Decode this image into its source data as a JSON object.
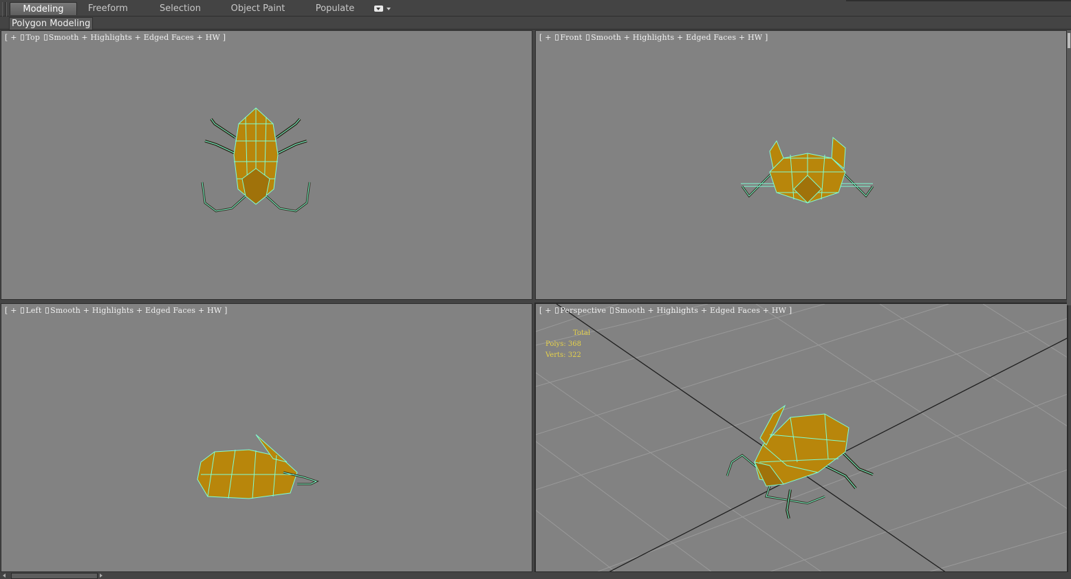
{
  "ribbon": {
    "tabs": [
      {
        "label": "Modeling",
        "active": true
      },
      {
        "label": "Freeform",
        "active": false
      },
      {
        "label": "Selection",
        "active": false
      },
      {
        "label": "Object Paint",
        "active": false
      },
      {
        "label": "Populate",
        "active": false
      }
    ],
    "panel_label": "Polygon Modeling"
  },
  "viewports": {
    "top": {
      "plus": "+",
      "view": "Top",
      "mode": "Smooth + Highlights + Edged Faces + HW"
    },
    "front": {
      "plus": "+",
      "view": "Front",
      "mode": "Smooth + Highlights + Edged Faces + HW"
    },
    "left": {
      "plus": "+",
      "view": "Left",
      "mode": "Smooth + Highlights + Edged Faces + HW"
    },
    "perspective": {
      "plus": "+",
      "view": "Perspective",
      "mode": "Smooth + Highlights + Edged Faces + HW",
      "stats": {
        "total_label": "Total",
        "polys_label": "Polys:",
        "polys": "368",
        "verts_label": "Verts:",
        "verts": "322"
      }
    }
  },
  "colors": {
    "viewport_bg": "#828282",
    "model_fill": "#b8860b",
    "wireframe": "#7fffd4",
    "stats_text": "#e6d24a"
  },
  "icons": {
    "ribbon_menu": "dropdown-icon",
    "model": "beetle-model"
  }
}
